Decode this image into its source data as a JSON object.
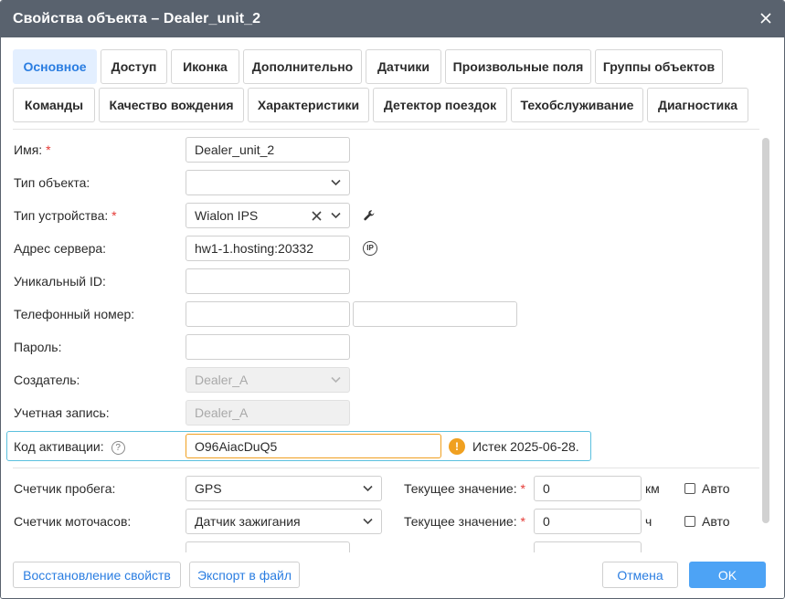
{
  "window": {
    "title": "Свойства объекта – Dealer_unit_2"
  },
  "tabs_row1": [
    "Основное",
    "Доступ",
    "Иконка",
    "Дополнительно",
    "Датчики",
    "Произвольные поля",
    "Группы объектов"
  ],
  "tabs_row2": [
    "Команды",
    "Качество вождения",
    "Характеристики",
    "Детектор поездок",
    "Техобслуживание",
    "Диагностика"
  ],
  "active_tab": "Основное",
  "form": {
    "name": {
      "label": "Имя:",
      "required": "*",
      "value": "Dealer_unit_2"
    },
    "object_type": {
      "label": "Тип объекта:",
      "value": ""
    },
    "device_type": {
      "label": "Тип устройства:",
      "required": "*",
      "value": "Wialon IPS"
    },
    "server_address": {
      "label": "Адрес сервера:",
      "value": "hw1-1.hosting:20332",
      "icon_text": "IP"
    },
    "unique_id": {
      "label": "Уникальный ID:",
      "value": ""
    },
    "phone": {
      "label": "Телефонный номер:",
      "value1": "",
      "value2": ""
    },
    "password": {
      "label": "Пароль:",
      "value": ""
    },
    "creator": {
      "label": "Создатель:",
      "value": "Dealer_A"
    },
    "account": {
      "label": "Учетная запись:",
      "value": "Dealer_A"
    },
    "activation_code": {
      "label": "Код активации:",
      "help": "?",
      "value": "O96AiacDuQ5",
      "warning_icon": "!",
      "warning": "Истек 2025-06-28."
    },
    "mileage_counter": {
      "label": "Счетчик пробега:",
      "value": "GPS",
      "current_label": "Текущее значение:",
      "required": "*",
      "current_value": "0",
      "unit": "км",
      "auto_label": "Авто"
    },
    "engine_hours_counter": {
      "label": "Счетчик моточасов:",
      "value": "Датчик зажигания",
      "current_label": "Текущее значение:",
      "required": "*",
      "current_value": "0",
      "unit": "ч",
      "auto_label": "Авто"
    }
  },
  "footer": {
    "restore_label": "Восстановление свойств",
    "export_label": "Экспорт в файл",
    "cancel_label": "Отмена",
    "ok_label": "OK"
  },
  "colors": {
    "titlebar": "#59626e",
    "accent": "#2a7de1",
    "active_tab_bg": "#e3efff",
    "primary_button": "#4da3f5",
    "warning": "#f0a020",
    "focus_border": "#5bc0de",
    "required": "#e53935"
  },
  "icons": {
    "close": "close-icon",
    "chevron": "chevron-down-icon",
    "clear": "clear-icon",
    "wrench": "wrench-icon",
    "ip": "ip-icon",
    "help": "help-icon",
    "warning": "warning-icon"
  }
}
